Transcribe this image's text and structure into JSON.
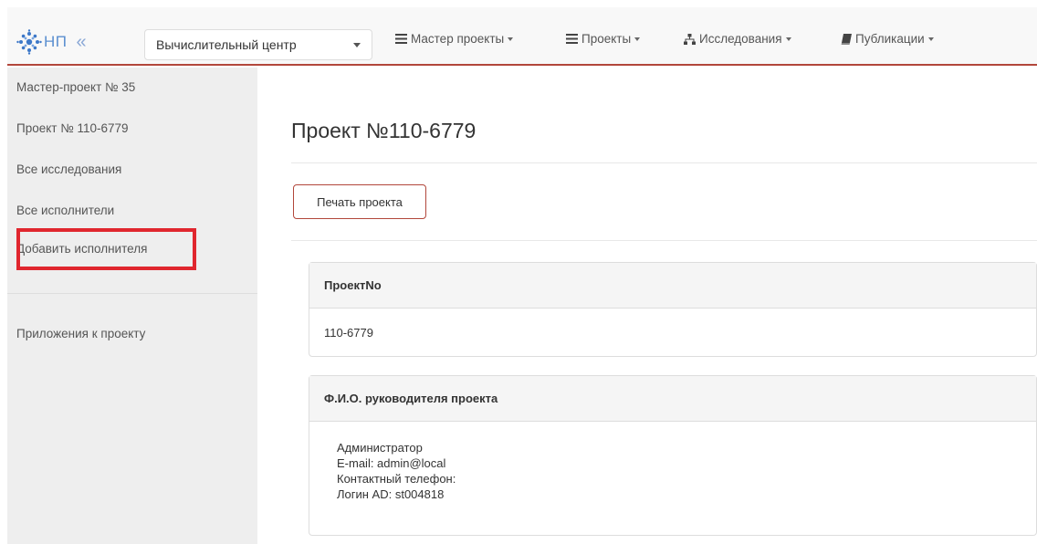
{
  "brand": {
    "text": "НП",
    "collapse_glyph": "«"
  },
  "center_select": {
    "value": "Вычислительный центр"
  },
  "nav": [
    {
      "icon": "list-icon",
      "label": "Мастер проекты"
    },
    {
      "icon": "list-icon",
      "label": "Проекты"
    },
    {
      "icon": "sitemap-icon",
      "label": "Исследования"
    },
    {
      "icon": "book-icon",
      "label": "Публикации"
    }
  ],
  "sidebar": {
    "items": [
      {
        "label": "Мастер-проект № 35"
      },
      {
        "label": "Проект № 110-6779"
      },
      {
        "label": "Все исследования"
      },
      {
        "label": "Все исполнители"
      },
      {
        "label": "Добавить исполнителя"
      },
      {
        "label": "Приложения к проекту"
      }
    ]
  },
  "main": {
    "title": "Проект №110-6779",
    "print_button": "Печать проекта",
    "panels": [
      {
        "heading": "ПроектNo",
        "lines": [
          "110-6779"
        ]
      },
      {
        "heading": "Ф.И.О. руководителя проекта",
        "lines": [
          "Администратор",
          "E-mail: admin@local",
          "Контактный телефон:",
          "Логин AD: st004818"
        ]
      }
    ]
  },
  "colors": {
    "accent": "#b2473b",
    "highlight": "#e0262e",
    "brand": "#5b8fd0"
  }
}
